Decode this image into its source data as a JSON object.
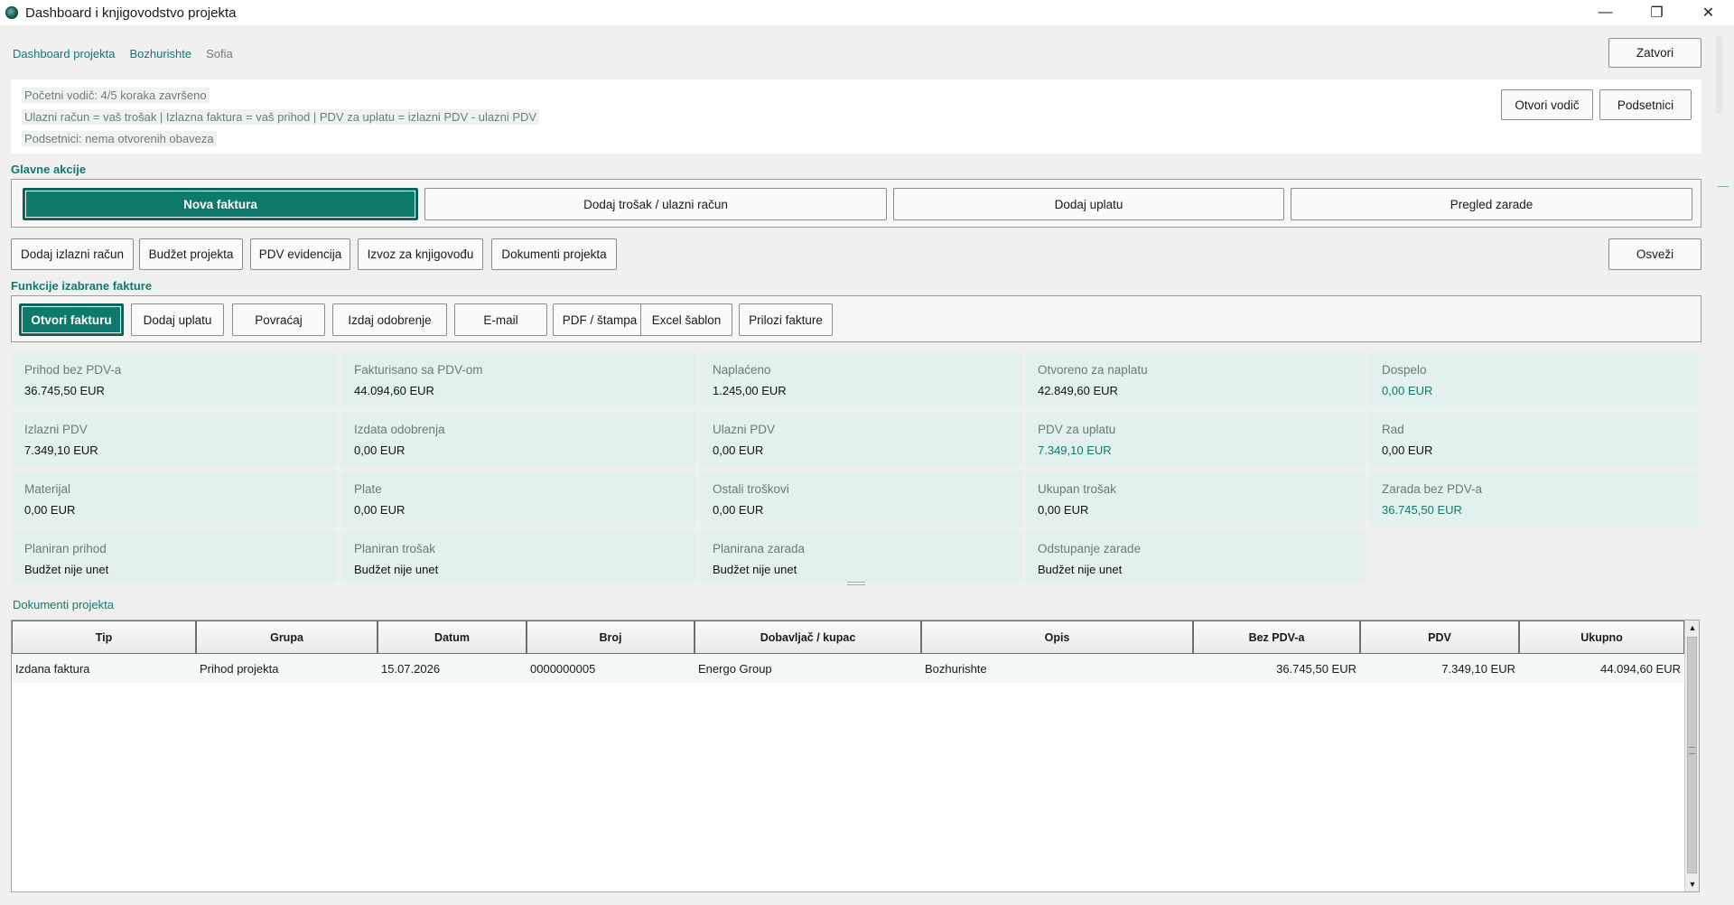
{
  "window": {
    "title": "Dashboard i knjigovodstvo projekta",
    "controls": [
      "—",
      "❐",
      "✕"
    ]
  },
  "breadcrumb": [
    {
      "label": "Dashboard projekta",
      "link": true
    },
    {
      "label": "Bozhurishte",
      "link": true
    },
    {
      "label": "Sofia",
      "link": false
    }
  ],
  "header": {
    "close_label": "Zatvori",
    "guide_label": "Otvori vodič",
    "reminders_label": "Podsetnici"
  },
  "info": {
    "line1": "Početni vodič: 4/5 koraka završeno",
    "line2": "Ulazni račun = vaš trošak | Izlazna faktura = vaš prihod | PDV za uplatu = izlazni PDV - ulazni PDV",
    "line3": "Podsetnici: nema otvorenih obaveza"
  },
  "main_actions": {
    "title": "Glavne akcije",
    "new_invoice": "Nova faktura",
    "add_cost": "Dodaj trošak / ulazni račun",
    "add_payment": "Dodaj uplatu",
    "profit_review": "Pregled zarade"
  },
  "secondary_actions": {
    "add_outgoing": "Dodaj izlazni račun",
    "budget": "Budžet projekta",
    "vat": "PDV evidencija",
    "export": "Izvoz za knjigovođu",
    "documents": "Dokumenti projekta",
    "refresh": "Osveži"
  },
  "invoice_functions": {
    "title": "Funkcije izabrane fakture",
    "open": "Otvori fakturu",
    "add_payment": "Dodaj uplatu",
    "refund": "Povraćaj",
    "credit_note": "Izdaj odobrenje",
    "email": "E-mail",
    "pdf": "PDF / štampa",
    "excel": "Excel šablon",
    "attachments": "Prilozi fakture"
  },
  "kpis": {
    "r1": [
      {
        "label": "Prihod bez PDV-a",
        "value": "36.745,50 EUR"
      },
      {
        "label": "Fakturisano sa PDV-om",
        "value": "44.094,60 EUR"
      },
      {
        "label": "Naplaćeno",
        "value": "1.245,00 EUR"
      },
      {
        "label": "Otvoreno za naplatu",
        "value": "42.849,60 EUR"
      },
      {
        "label": "Dospelo",
        "value": "0,00 EUR"
      }
    ],
    "r2": [
      {
        "label": "Izlazni PDV",
        "value": "7.349,10 EUR"
      },
      {
        "label": "Izdata odobrenja",
        "value": "0,00 EUR"
      },
      {
        "label": "Ulazni PDV",
        "value": "0,00 EUR"
      },
      {
        "label": "PDV za uplatu",
        "value": "7.349,10 EUR"
      },
      {
        "label": "Rad",
        "value": "0,00 EUR"
      }
    ],
    "r3": [
      {
        "label": "Materijal",
        "value": "0,00 EUR"
      },
      {
        "label": "Plate",
        "value": "0,00 EUR"
      },
      {
        "label": "Ostali troškovi",
        "value": "0,00 EUR"
      },
      {
        "label": "Ukupan trošak",
        "value": "0,00 EUR"
      },
      {
        "label": "Zarada bez PDV-a",
        "value": "36.745,50 EUR"
      }
    ],
    "r4": [
      {
        "label": "Planiran prihod",
        "value": "Budžet nije unet"
      },
      {
        "label": "Planiran trošak",
        "value": "Budžet nije unet"
      },
      {
        "label": "Planirana zarada",
        "value": "Budžet nije unet"
      },
      {
        "label": "Odstupanje zarade",
        "value": "Budžet nije unet"
      }
    ]
  },
  "documents": {
    "title": "Dokumenti projekta",
    "columns": [
      "Tip",
      "Grupa",
      "Datum",
      "Broj",
      "Dobavljač / kupac",
      "Opis",
      "Bez PDV-a",
      "PDV",
      "Ukupno"
    ],
    "rows": [
      [
        "Izdana faktura",
        "Prihod projekta",
        "15.07.2026",
        "0000000005",
        "Energo Group",
        "Bozhurishte",
        "36.745,50 EUR",
        "7.349,10 EUR",
        "44.094,60 EUR"
      ]
    ]
  },
  "colors": {
    "accent": "#0f7a6c",
    "kpi_bg": "#e3f1ee"
  }
}
